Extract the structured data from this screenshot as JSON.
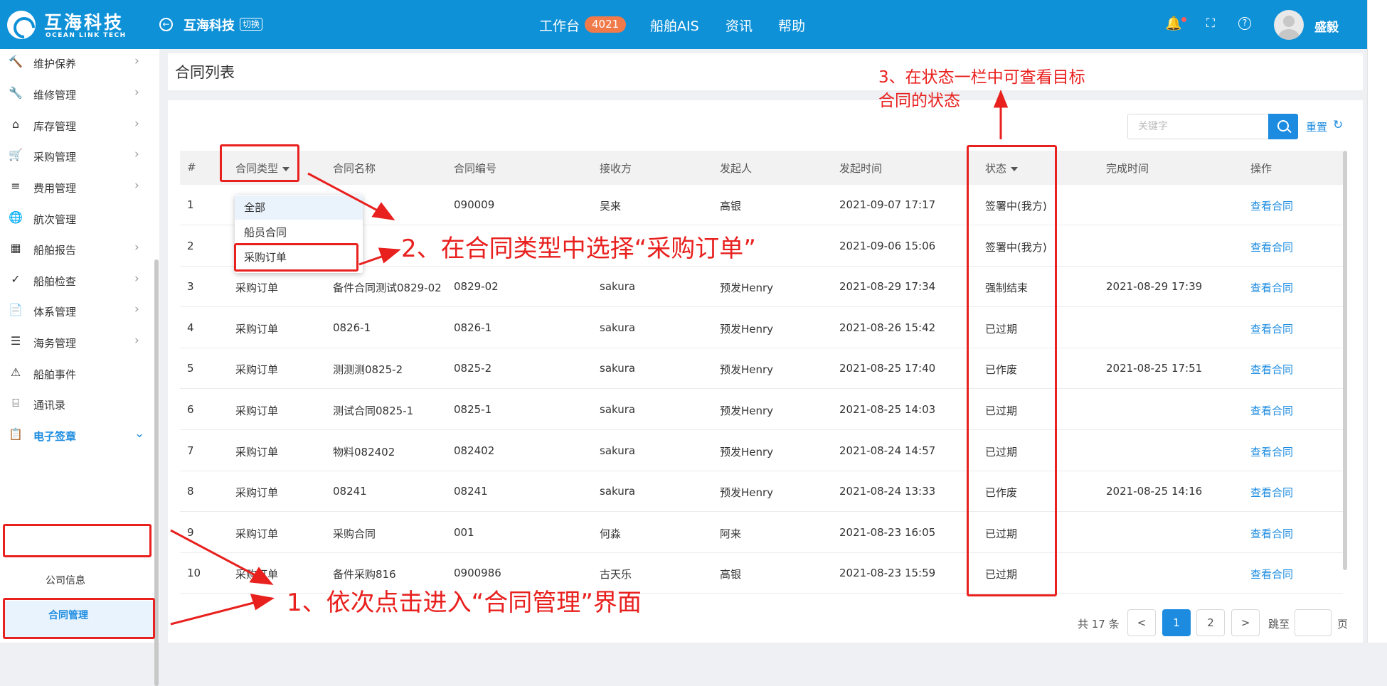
{
  "header": {
    "logo_cn": "互海科技",
    "logo_en": "OCEAN LINK TECH",
    "company": "互海科技",
    "switch_label": "切换",
    "nav": [
      "工作台",
      "船舶AIS",
      "资讯",
      "帮助"
    ],
    "workbench_badge": "4021",
    "username": "盛毅"
  },
  "sidebar": {
    "items": [
      {
        "label": "维护保养",
        "icon": "hammer-icon"
      },
      {
        "label": "维修管理",
        "icon": "wrench-icon"
      },
      {
        "label": "库存管理",
        "icon": "warehouse-icon"
      },
      {
        "label": "采购管理",
        "icon": "cart-icon"
      },
      {
        "label": "费用管理",
        "icon": "coins-icon"
      },
      {
        "label": "航次管理",
        "icon": "globe-icon"
      },
      {
        "label": "船舶报告",
        "icon": "calendar-icon"
      },
      {
        "label": "船舶检查",
        "icon": "check-circle-icon"
      },
      {
        "label": "体系管理",
        "icon": "documents-icon"
      },
      {
        "label": "海务管理",
        "icon": "signpost-icon"
      },
      {
        "label": "船舶事件",
        "icon": "warning-icon"
      },
      {
        "label": "通讯录",
        "icon": "contacts-icon"
      },
      {
        "label": "电子签章",
        "icon": "seal-doc-icon"
      }
    ],
    "sub_items": [
      "公司信息",
      "合同管理"
    ]
  },
  "page": {
    "title": "合同列表",
    "search_placeholder": "关键字",
    "reset_label": "重置"
  },
  "table": {
    "columns": [
      "#",
      "合同类型",
      "合同名称",
      "合同编号",
      "接收方",
      "发起人",
      "发起时间",
      "状态",
      "完成时间",
      "操作"
    ],
    "rows": [
      [
        "1",
        "",
        "",
        "090009",
        "吴来",
        "高银",
        "2021-09-07 17:17",
        "签署中(我方)",
        "",
        "查看合同"
      ],
      [
        "2",
        "",
        "",
        "",
        "",
        "",
        "2021-09-06 15:06",
        "签署中(我方)",
        "",
        "查看合同"
      ],
      [
        "3",
        "采购订单",
        "备件合同测试0829-02",
        "0829-02",
        "sakura",
        "预发Henry",
        "2021-08-29 17:34",
        "强制结束",
        "2021-08-29 17:39",
        "查看合同"
      ],
      [
        "4",
        "采购订单",
        "0826-1",
        "0826-1",
        "sakura",
        "预发Henry",
        "2021-08-26 15:42",
        "已过期",
        "",
        "查看合同"
      ],
      [
        "5",
        "采购订单",
        "测测测0825-2",
        "0825-2",
        "sakura",
        "预发Henry",
        "2021-08-25 17:40",
        "已作废",
        "2021-08-25 17:51",
        "查看合同"
      ],
      [
        "6",
        "采购订单",
        "测试合同0825-1",
        "0825-1",
        "sakura",
        "预发Henry",
        "2021-08-25 14:03",
        "已过期",
        "",
        "查看合同"
      ],
      [
        "7",
        "采购订单",
        "物料082402",
        "082402",
        "sakura",
        "预发Henry",
        "2021-08-24 14:57",
        "已过期",
        "",
        "查看合同"
      ],
      [
        "8",
        "采购订单",
        "08241",
        "08241",
        "sakura",
        "预发Henry",
        "2021-08-24 13:33",
        "已作废",
        "2021-08-25 14:16",
        "查看合同"
      ],
      [
        "9",
        "采购订单",
        "采购合同",
        "001",
        "何淼",
        "阿来",
        "2021-08-23 16:05",
        "已过期",
        "",
        "查看合同"
      ],
      [
        "10",
        "采购订单",
        "备件采购816",
        "0900986",
        "古天乐",
        "高银",
        "2021-08-23 15:59",
        "已过期",
        "",
        "查看合同"
      ]
    ]
  },
  "dropdown": {
    "options": [
      "全部",
      "船员合同",
      "采购订单"
    ]
  },
  "pagination": {
    "total": "共 17 条",
    "pages": [
      "1",
      "2"
    ],
    "current": "1",
    "prev": "<",
    "next": ">",
    "jump_label": "跳至",
    "page_unit": "页"
  },
  "annotations": {
    "step1": "1、依次点击进入“合同管理”界面",
    "step2": "2、在合同类型中选择“采购订单”",
    "step3_line1": "3、在状态一栏中可查看目标",
    "step3_line2": "合同的状态"
  },
  "colors": {
    "header_bg": "#0f91d8",
    "accent": "#1d8ce0",
    "annotation_red": "#e8201e",
    "badge": "#f07a4a"
  }
}
